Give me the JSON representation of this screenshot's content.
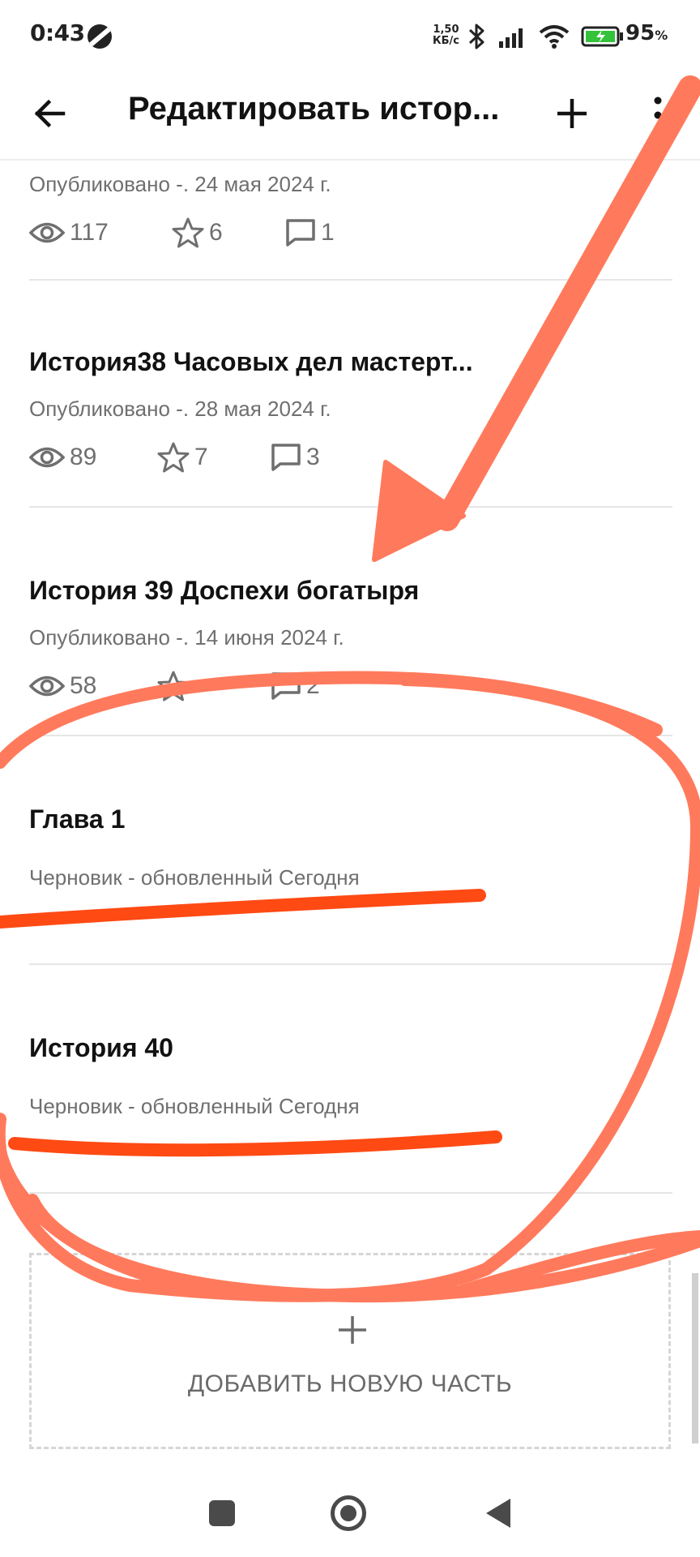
{
  "status_bar": {
    "time": "0:43",
    "speed_value": "1,50",
    "speed_unit": "КБ/с",
    "battery": "95",
    "battery_unit": "%"
  },
  "app_bar": {
    "title": "Редактировать истор..."
  },
  "parts": [
    {
      "title": "",
      "subtitle": "Опубликовано -. 24 мая 2024 г.",
      "views": "117",
      "votes": "6",
      "comments": "1"
    },
    {
      "title": "История38 Часовых дел мастерт...",
      "subtitle": "Опубликовано -. 28 мая 2024 г.",
      "views": "89",
      "votes": "7",
      "comments": "3"
    },
    {
      "title": "История 39 Доспехи богатыря",
      "subtitle": "Опубликовано -. 14 июня 2024 г.",
      "views": "58",
      "votes": "",
      "comments": "2"
    },
    {
      "title": "Глава 1",
      "subtitle": "Черновик - обновленный Сегодня"
    },
    {
      "title": "История 40",
      "subtitle": "Черновик - обновленный Сегодня"
    }
  ],
  "add_part": {
    "label": "ДОБАВИТЬ НОВУЮ ЧАСТЬ"
  },
  "colors": {
    "annotation_arrow": "#ff7a5c",
    "annotation_underline": "#ff4a14",
    "text_primary": "#121212",
    "text_secondary": "#6f6f6f"
  },
  "icons": {
    "views": "eye-icon",
    "votes": "star-icon",
    "comments": "comment-icon"
  }
}
